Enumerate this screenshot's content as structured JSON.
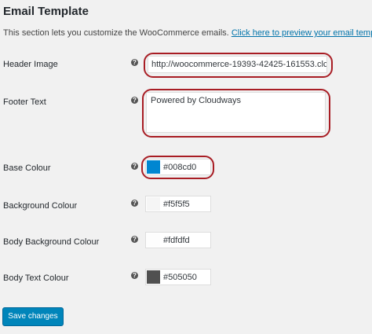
{
  "section": {
    "title": "Email Template",
    "description": "This section lets you customize the WooCommerce emails.",
    "preview_link": "Click here to preview your email template"
  },
  "fields": {
    "header_image": {
      "label": "Header Image",
      "value": "http://woocommerce-19393-42425-161553.clc"
    },
    "footer_text": {
      "label": "Footer Text",
      "value": "Powered by Cloudways"
    },
    "base_colour": {
      "label": "Base Colour",
      "value": "#008cd0",
      "swatch": "#0086d1"
    },
    "background_colour": {
      "label": "Background Colour",
      "value": "#f5f5f5",
      "swatch": "#f5f5f5"
    },
    "body_background_colour": {
      "label": "Body Background Colour",
      "value": "#fdfdfd",
      "swatch": "#fdfdfd"
    },
    "body_text_colour": {
      "label": "Body Text Colour",
      "value": "#505050",
      "swatch": "#505050"
    }
  },
  "help_icon": "?",
  "save_button": "Save changes",
  "colors": {
    "highlight": "#a81d24",
    "primary_button": "#0085ba",
    "link": "#0073aa"
  }
}
